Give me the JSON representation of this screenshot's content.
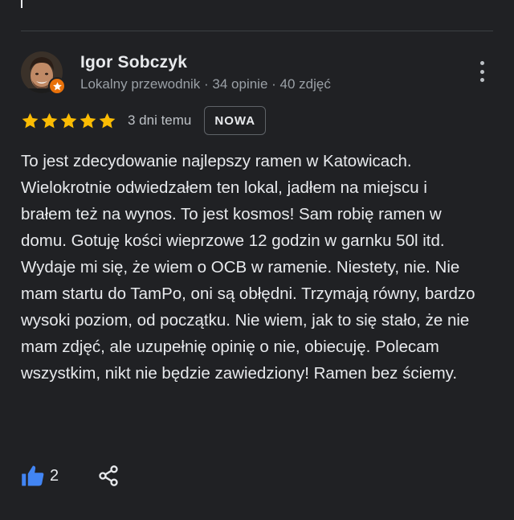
{
  "review": {
    "author_name": "Igor Sobczyk",
    "author_meta": "Lokalny przewodnik · 34 opinie · 40 zdjęć",
    "rating": 5,
    "date": "3 dni temu",
    "new_label": "NOWA",
    "text": "To jest zdecydowanie najlepszy ramen w Katowicach. Wielokrotnie odwiedzałem ten lokal, jadłem na miejscu i brałem też na wynos. To jest kosmos! Sam robię ramen w domu. Gotuję kości wieprzowe 12 godzin w garnku 50l itd. Wydaje mi się, że wiem o OCB w ramenie. Niestety, nie. Nie mam startu do TamPo, oni są obłędni. Trzymają równy, bardzo wysoki poziom, od początku. Nie wiem, jak to się stało, że nie mam zdjęć, ale uzupełnię opinię o nie, obiecuję. Polecam wszystkim, nikt nie będzie zawiedziony! Ramen bez ściemy.",
    "likes": "2"
  },
  "colors": {
    "background": "#202124",
    "star": "#fbbc04",
    "like_accent": "#4285f4",
    "badge": "#e8710a"
  },
  "icons": {
    "badge": "local-guide-star-icon",
    "menu": "more-vertical-icon",
    "like": "thumbs-up-icon",
    "share": "share-icon"
  }
}
